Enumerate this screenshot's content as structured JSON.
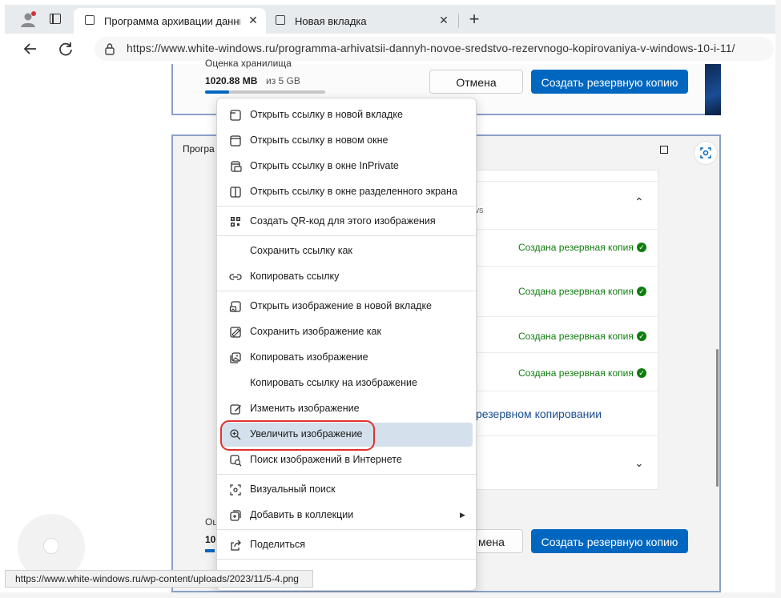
{
  "browser": {
    "tabs": [
      {
        "title": "Программа архивации данных",
        "close": "✕"
      },
      {
        "title": "Новая вкладка",
        "close": "✕"
      }
    ],
    "new_tab": "+",
    "url": "https://www.white-windows.ru/programma-arhivatsii-dannyh-novoe-sredstvo-rezervnogo-kopirovaniya-v-windows-10-i-11/"
  },
  "page": {
    "top_section": {
      "label": "Оценка хранилища",
      "value": "1020.88 МВ",
      "of": "из 5 GB",
      "usage_fraction": 0.2,
      "cancel": "Отмена",
      "primary": "Создать резервную копию"
    },
    "window2": {
      "title": "Програ",
      "ws_fragment": "ws",
      "statuses": [
        "Создана резервная копия",
        "Создана резервная копия",
        "Создана резервная копия",
        "Создана резервная копия"
      ],
      "link_fragment": "резервном копировании",
      "bottom_label": "Оц",
      "bottom_value": "10",
      "cancel_fragment": "мена",
      "primary": "Создать резервную копию"
    }
  },
  "context_menu": {
    "items": [
      {
        "label": "Открыть ссылку в новой вкладке",
        "icon": "new-tab-icon"
      },
      {
        "label": "Открыть ссылку в новом окне",
        "icon": "new-window-icon"
      },
      {
        "label": "Открыть ссылку в окне InPrivate",
        "icon": "inprivate-icon"
      },
      {
        "label": "Открыть ссылку в окне разделенного экрана",
        "icon": "split-screen-icon"
      },
      {
        "label": "Создать QR-код для этого изображения",
        "icon": "qr-code-icon"
      },
      {
        "label": "Сохранить ссылку как",
        "icon": ""
      },
      {
        "label": "Копировать ссылку",
        "icon": "link-icon"
      },
      {
        "label": "Открыть изображение в новой вкладке",
        "icon": "image-new-tab-icon"
      },
      {
        "label": "Сохранить изображение как",
        "icon": "save-image-icon"
      },
      {
        "label": "Копировать изображение",
        "icon": "copy-image-icon"
      },
      {
        "label": "Копировать ссылку на изображение",
        "icon": ""
      },
      {
        "label": "Изменить изображение",
        "icon": "edit-image-icon"
      },
      {
        "label": "Увеличить изображение",
        "icon": "zoom-in-icon",
        "highlighted": true
      },
      {
        "label": "Поиск изображений в Интернете",
        "icon": "image-search-icon"
      },
      {
        "label": "Визуальный поиск",
        "icon": "visual-search-icon"
      },
      {
        "label": "Добавить в коллекции",
        "icon": "collections-icon",
        "submenu": true
      },
      {
        "label": "Поделиться",
        "icon": "share-icon"
      }
    ]
  },
  "statusbar": {
    "link": "https://www.white-windows.ru/wp-content/uploads/2023/11/5-4.png"
  },
  "colors": {
    "accent": "#0067c0",
    "success": "#107c10",
    "highlight": "#d4e1ec",
    "annotation": "#e0312f"
  }
}
